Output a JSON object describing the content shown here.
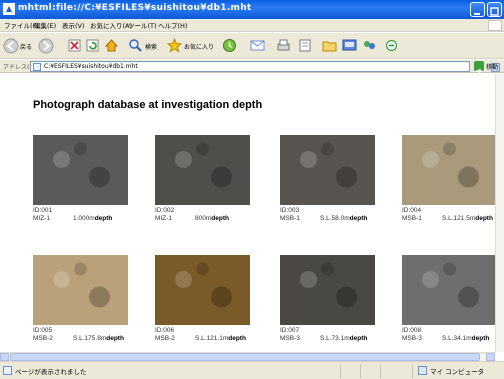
{
  "window": {
    "title": "mhtml:file://C:¥ESFILES¥suishitou¥db1.mht"
  },
  "menu": {
    "items": [
      "ファイル(F)",
      "編集(E)",
      "表示(V)",
      "お気に入り(A)",
      "ツール(T)",
      "ヘルプ(H)"
    ]
  },
  "toolbar": {
    "back_label": "戻る",
    "search_label": "検索",
    "favorites_label": "お気に入り"
  },
  "address": {
    "label": "アドレス(D)",
    "value": "C:¥ESFILES¥suishitou¥db1.mht",
    "go_label": "移動"
  },
  "page": {
    "title": "Photograph database at investigation depth",
    "depth_word": "depth",
    "photos": [
      {
        "id": "ID:001",
        "site": "MIZ-1",
        "depth": "1.000m",
        "image_color": "#5a5a5a"
      },
      {
        "id": "ID:002",
        "site": "MIZ-1",
        "depth": "800m",
        "image_color": "#4e4e4a"
      },
      {
        "id": "ID:003",
        "site": "MSB-1",
        "depth": "S.L.58.0m",
        "image_color": "#585450"
      },
      {
        "id": "ID:004",
        "site": "MSB-1",
        "depth": "S.L.121.5m",
        "image_color": "#a89a7a"
      },
      {
        "id": "ID:005",
        "site": "MSB-2",
        "depth": "S.L.175.8m",
        "image_color": "#b9a27a"
      },
      {
        "id": "ID:006",
        "site": "MSB-2",
        "depth": "S.L.121.1m",
        "image_color": "#7a5a28"
      },
      {
        "id": "ID:007",
        "site": "MSB-3",
        "depth": "S.L.73.1m",
        "image_color": "#4a4844"
      },
      {
        "id": "ID:008",
        "site": "MSB-3",
        "depth": "S.L.34.1m",
        "image_color": "#6e6e6e"
      }
    ]
  },
  "status": {
    "text": "ページが表示されました",
    "zone": "マイ コンピュータ"
  }
}
